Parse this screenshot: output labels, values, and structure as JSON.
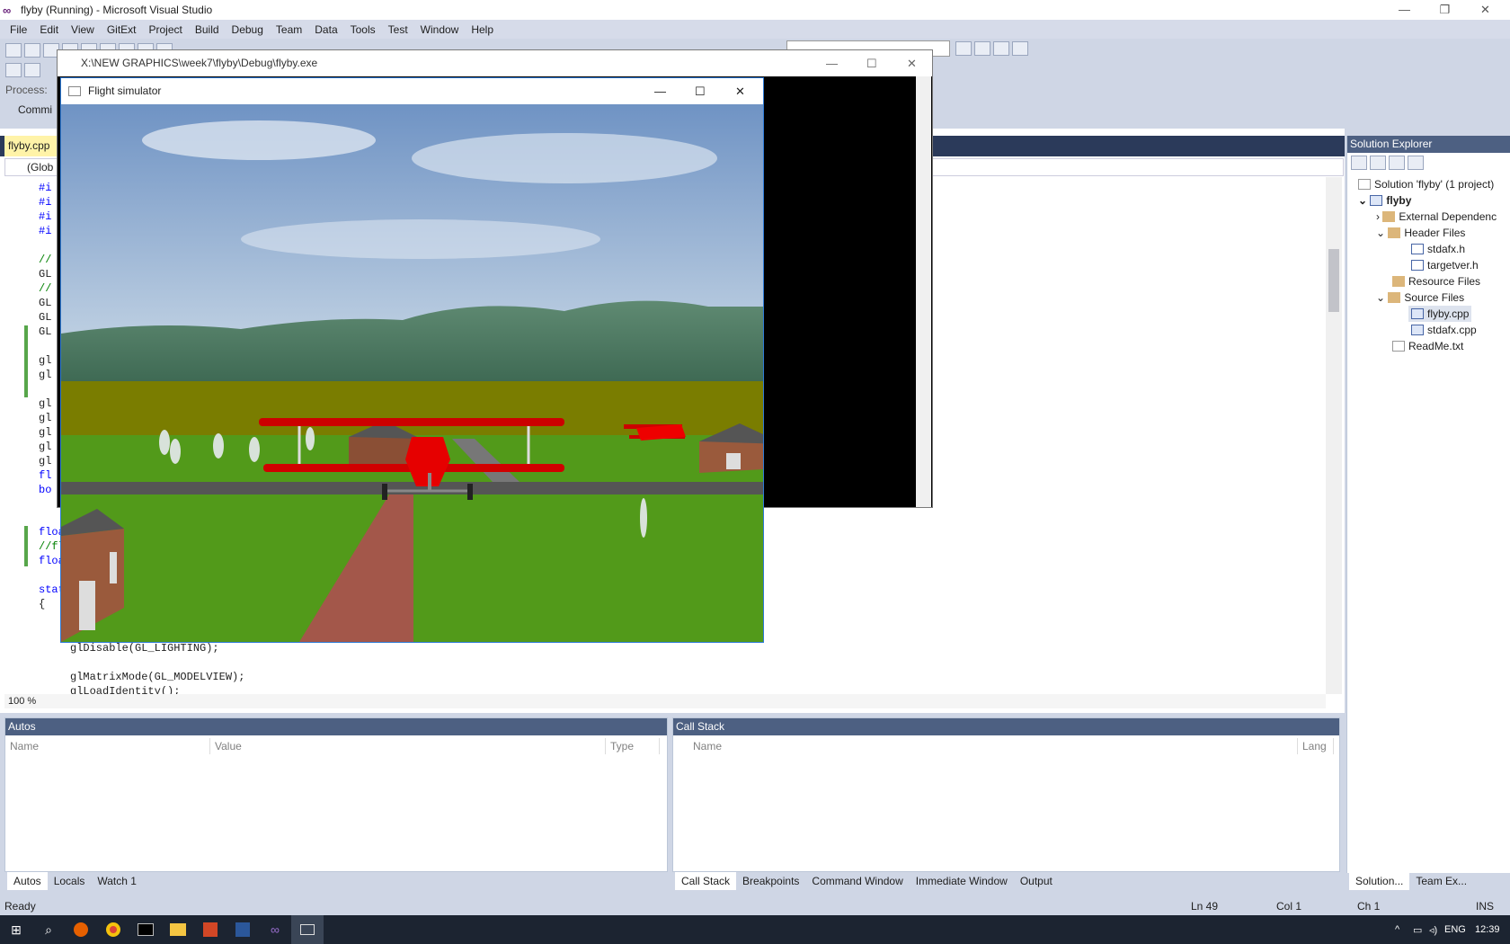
{
  "window": {
    "title": "flyby (Running) - Microsoft Visual Studio",
    "min": "—",
    "max": "❐",
    "close": "✕"
  },
  "menu": [
    "File",
    "Edit",
    "View",
    "GitExt",
    "Project",
    "Build",
    "Debug",
    "Team",
    "Data",
    "Tools",
    "Test",
    "Window",
    "Help"
  ],
  "toolbar": {
    "process_label": "Process:",
    "commit_label": "Commi"
  },
  "document": {
    "tab": "flyby.cpp",
    "nav_scope": "(Glob"
  },
  "code": {
    "line1": "#i",
    "line2": "#i",
    "line3": "#i",
    "line4": "#i",
    "line5": "//",
    "line6": "GL",
    "line7": "//",
    "line8": "GL",
    "line9": "GL",
    "line10": "GL",
    "line11": "gl",
    "line12": "gl",
    "line13": "gl",
    "line14": "gl",
    "line15": "gl",
    "line16": "gl",
    "line17": "gl",
    "line18": "fl",
    "line19": "bo",
    "line20": "floa",
    "line21": "//fl",
    "line22": "floa",
    "line23": "stat",
    "line24": "{",
    "line25": "glDisable(GL_LIGHTING);",
    "line26": "glMatrixMode(GL_MODELVIEW);",
    "line27": "glLoadIdentity();"
  },
  "zoom": "100 %",
  "console_window": {
    "title": "X:\\NEW GRAPHICS\\week7\\flyby\\Debug\\flyby.exe"
  },
  "sim_window": {
    "title": "Flight simulator"
  },
  "autos": {
    "title": "Autos",
    "cols": [
      "Name",
      "Value",
      "Type"
    ]
  },
  "callstack": {
    "title": "Call Stack",
    "cols": [
      "Name",
      "Lang"
    ]
  },
  "bottom_tabs_left": [
    "Autos",
    "Locals",
    "Watch 1"
  ],
  "bottom_tabs_right": [
    "Call Stack",
    "Breakpoints",
    "Command Window",
    "Immediate Window",
    "Output"
  ],
  "solution_explorer": {
    "title": "Solution Explorer",
    "solution": "Solution 'flyby' (1 project)",
    "project": "flyby",
    "external": "External Dependenc",
    "header_files": "Header Files",
    "stdafx_h": "stdafx.h",
    "targetver_h": "targetver.h",
    "resource_files": "Resource Files",
    "source_files": "Source Files",
    "flyby_cpp": "flyby.cpp",
    "stdafx_cpp": "stdafx.cpp",
    "readme": "ReadMe.txt",
    "tab1": "Solution...",
    "tab2": "Team Ex..."
  },
  "status": {
    "ready": "Ready",
    "ln": "Ln 49",
    "col": "Col 1",
    "ch": "Ch 1",
    "ins": "INS"
  },
  "taskbar": {
    "lang": "ENG",
    "time": "12:39"
  }
}
